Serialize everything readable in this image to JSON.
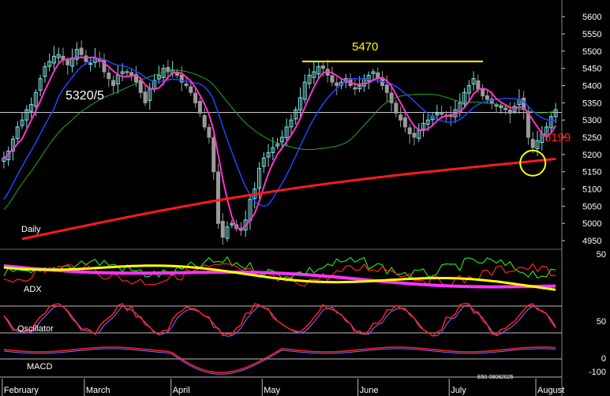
{
  "chart_data": {
    "type": "candlestick",
    "colors": {
      "background": "#000000",
      "candle_up": "#7ee0e0",
      "candle_down": "#9a9a9a",
      "ma_short": "#ff33cc",
      "ma_mid": "#2244ff",
      "ma_long": "#22aa22",
      "ma_200": "#ff1a1a",
      "resistance": "#ffff00",
      "level_line": "#c8c8c8",
      "indicator_green": "#22dd22",
      "indicator_red": "#ff2020",
      "indicator_yellow": "#ffff00",
      "indicator_magenta": "#ff33ff",
      "signal_purple": "#9966ff",
      "text": "#ffffff"
    },
    "price_axis": {
      "ticks": [
        4950,
        5000,
        5050,
        5100,
        5150,
        5200,
        5250,
        5300,
        5350,
        5400,
        5450,
        5500,
        5550,
        5600
      ],
      "ylim": [
        4925,
        5630
      ]
    },
    "months": [
      "February",
      "March",
      "April",
      "May",
      "June",
      "July",
      "August"
    ],
    "annotations": {
      "resistance_label": "5470",
      "resistance_level": 5470,
      "support_label": "5320/5",
      "support_level": 5322,
      "ma_200_label": "5199",
      "circle_target": 5175
    },
    "panel_labels": {
      "daily": "Daily",
      "adx": "ADX",
      "oscillator": "Oscillator",
      "macd": "MACD"
    },
    "indicator_ticks": {
      "adx": [
        "50"
      ],
      "oscillator": [
        "50"
      ],
      "macd": [
        "0",
        "-100"
      ]
    },
    "footer_code": "E50 08082025",
    "close": [
      5190,
      5210,
      5245,
      5280,
      5300,
      5330,
      5345,
      5380,
      5420,
      5455,
      5470,
      5485,
      5490,
      5475,
      5460,
      5480,
      5505,
      5490,
      5470,
      5465,
      5480,
      5470,
      5440,
      5420,
      5400,
      5430,
      5440,
      5440,
      5430,
      5410,
      5380,
      5350,
      5390,
      5415,
      5430,
      5450,
      5440,
      5445,
      5430,
      5410,
      5400,
      5380,
      5350,
      5320,
      5280,
      5250,
      5150,
      5000,
      4960,
      4990,
      5000,
      4985,
      4980,
      5010,
      5070,
      5100,
      5160,
      5190,
      5205,
      5220,
      5230,
      5250,
      5280,
      5300,
      5330,
      5365,
      5410,
      5430,
      5440,
      5455,
      5450,
      5430,
      5410,
      5400,
      5410,
      5420,
      5400,
      5390,
      5400,
      5420,
      5430,
      5440,
      5420,
      5400,
      5380,
      5350,
      5320,
      5300,
      5280,
      5260,
      5250,
      5270,
      5290,
      5300,
      5310,
      5320,
      5320,
      5310,
      5310,
      5330,
      5350,
      5380,
      5400,
      5420,
      5390,
      5370,
      5360,
      5350,
      5340,
      5340,
      5330,
      5320,
      5340,
      5360,
      5330,
      5250,
      5220,
      5240,
      5260,
      5280,
      5310,
      5330
    ]
  }
}
